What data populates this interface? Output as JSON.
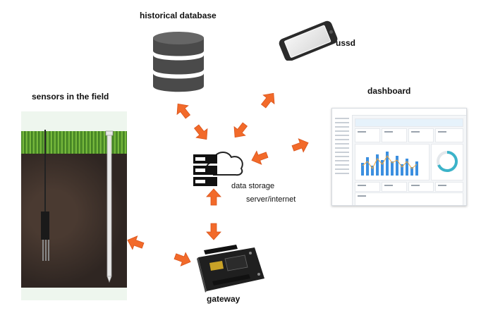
{
  "labels": {
    "historical_database": "historical database",
    "ussd": "ussd",
    "sensors": "sensors in the field",
    "dashboard": "dashboard",
    "data_storage": "data storage",
    "server_internet": "server/internet",
    "gateway": "gateway"
  },
  "colors": {
    "arrow": "#f26a2a",
    "arrow_dark": "#d9531a",
    "database": "#4a4a4a",
    "phone": "#2b2b2b",
    "dashboard_accent": "#3b8fe0",
    "gateway_board": "#1f1f1f"
  },
  "icons": {
    "database": "database-cylinder-icon",
    "phone": "smartphone-icon",
    "server_cloud": "server-cloud-icon",
    "gateway": "microcontroller-board-icon"
  }
}
